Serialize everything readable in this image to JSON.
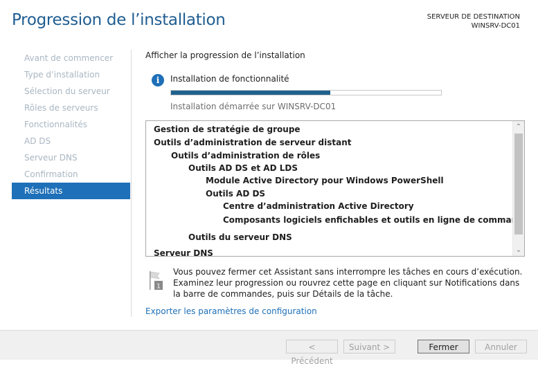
{
  "window": {
    "title": "Progression de l’installation",
    "destination_label": "SERVEUR DE DESTINATION",
    "destination_server": "WINSRV-DC01"
  },
  "nav": {
    "items": [
      {
        "label": "Avant de commencer",
        "active": false
      },
      {
        "label": "Type d’installation",
        "active": false
      },
      {
        "label": "Sélection du serveur",
        "active": false
      },
      {
        "label": "Rôles de serveurs",
        "active": false
      },
      {
        "label": "Fonctionnalités",
        "active": false
      },
      {
        "label": "AD DS",
        "active": false
      },
      {
        "label": "Serveur DNS",
        "active": false
      },
      {
        "label": "Confirmation",
        "active": false
      },
      {
        "label": "Résultats",
        "active": true
      }
    ]
  },
  "main": {
    "heading": "Afficher la progression de l’installation",
    "feature_label": "Installation de fonctionnalité",
    "progress": 0.59,
    "started_text": "Installation démarrée sur WINSRV-DC01",
    "features": [
      {
        "text": "Gestion de stratégie de groupe",
        "level": 0
      },
      {
        "text": "Outils d’administration de serveur distant",
        "level": 0
      },
      {
        "text": "Outils d’administration de rôles",
        "level": 1
      },
      {
        "text": "Outils AD DS et AD LDS",
        "level": 2
      },
      {
        "text": "Module Active Directory pour Windows PowerShell",
        "level": 3
      },
      {
        "text": "Outils AD DS",
        "level": 3
      },
      {
        "text": "Centre d’administration Active Directory",
        "level": 4
      },
      {
        "text": "Composants logiciels enfichables et outils en ligne de commande AD DS",
        "level": 4
      },
      {
        "text": "Outils du serveur DNS",
        "level": 2
      },
      {
        "text": "Serveur DNS",
        "level": 0
      }
    ],
    "note": "Vous pouvez fermer cet Assistant sans interrompre les tâches en cours d’exécution. Examinez leur progression ou rouvrez cette page en cliquant sur Notifications dans la barre de commandes, puis sur Détails de la tâche.",
    "export_link": "Exporter les paramètres de configuration"
  },
  "buttons": {
    "previous": "< Précédent",
    "next": "Suivant >",
    "close": "Fermer",
    "cancel": "Annuler"
  }
}
